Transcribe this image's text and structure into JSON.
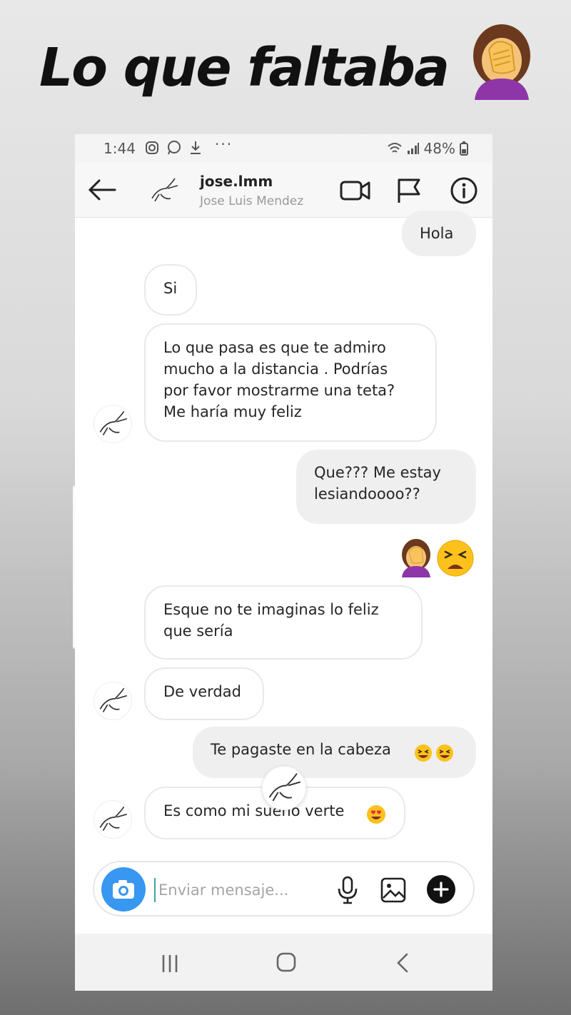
{
  "story": {
    "caption": "Lo que faltaba"
  },
  "status_bar": {
    "time": "1:44",
    "dots": "···",
    "battery": "48%"
  },
  "header": {
    "username": "jose.lmm",
    "full_name": "Jose Luis Mendez"
  },
  "messages": [
    {
      "side": "out",
      "text": "Hola"
    },
    {
      "side": "in",
      "text": "Si"
    },
    {
      "side": "in",
      "text": "Lo que pasa es que te admiro\nmucho a la distancia . Podrías\npor favor mostrarme una teta?\nMe haría muy feliz"
    },
    {
      "side": "out",
      "text": "Que??? Me estay\nlesiandoooo??"
    },
    {
      "side": "in",
      "text": "Esque no te imaginas lo feliz\nque sería"
    },
    {
      "side": "in",
      "text": "De verdad"
    },
    {
      "side": "out",
      "text": "Te pagaste en la cabeza"
    },
    {
      "side": "in",
      "text": "Es como mi sueño verte"
    }
  ],
  "composer": {
    "placeholder": "Enviar mensaje..."
  },
  "colors": {
    "accent": "#3897f0",
    "bubble_out": "#efefef",
    "bubble_in_border": "#e9e9e9"
  },
  "icons": [
    "instagram-icon",
    "whatsapp-icon",
    "download-icon",
    "wifi-icon",
    "signal-icon",
    "battery-icon",
    "back-arrow-icon",
    "video-call-icon",
    "flag-icon",
    "info-icon",
    "camera-icon",
    "microphone-icon",
    "gallery-icon",
    "plus-icon",
    "nav-recents-icon",
    "nav-home-icon",
    "nav-back-icon",
    "facepalm-emoji",
    "tired-face-emoji",
    "grinning-squint-emoji",
    "heart-eyes-emoji"
  ]
}
